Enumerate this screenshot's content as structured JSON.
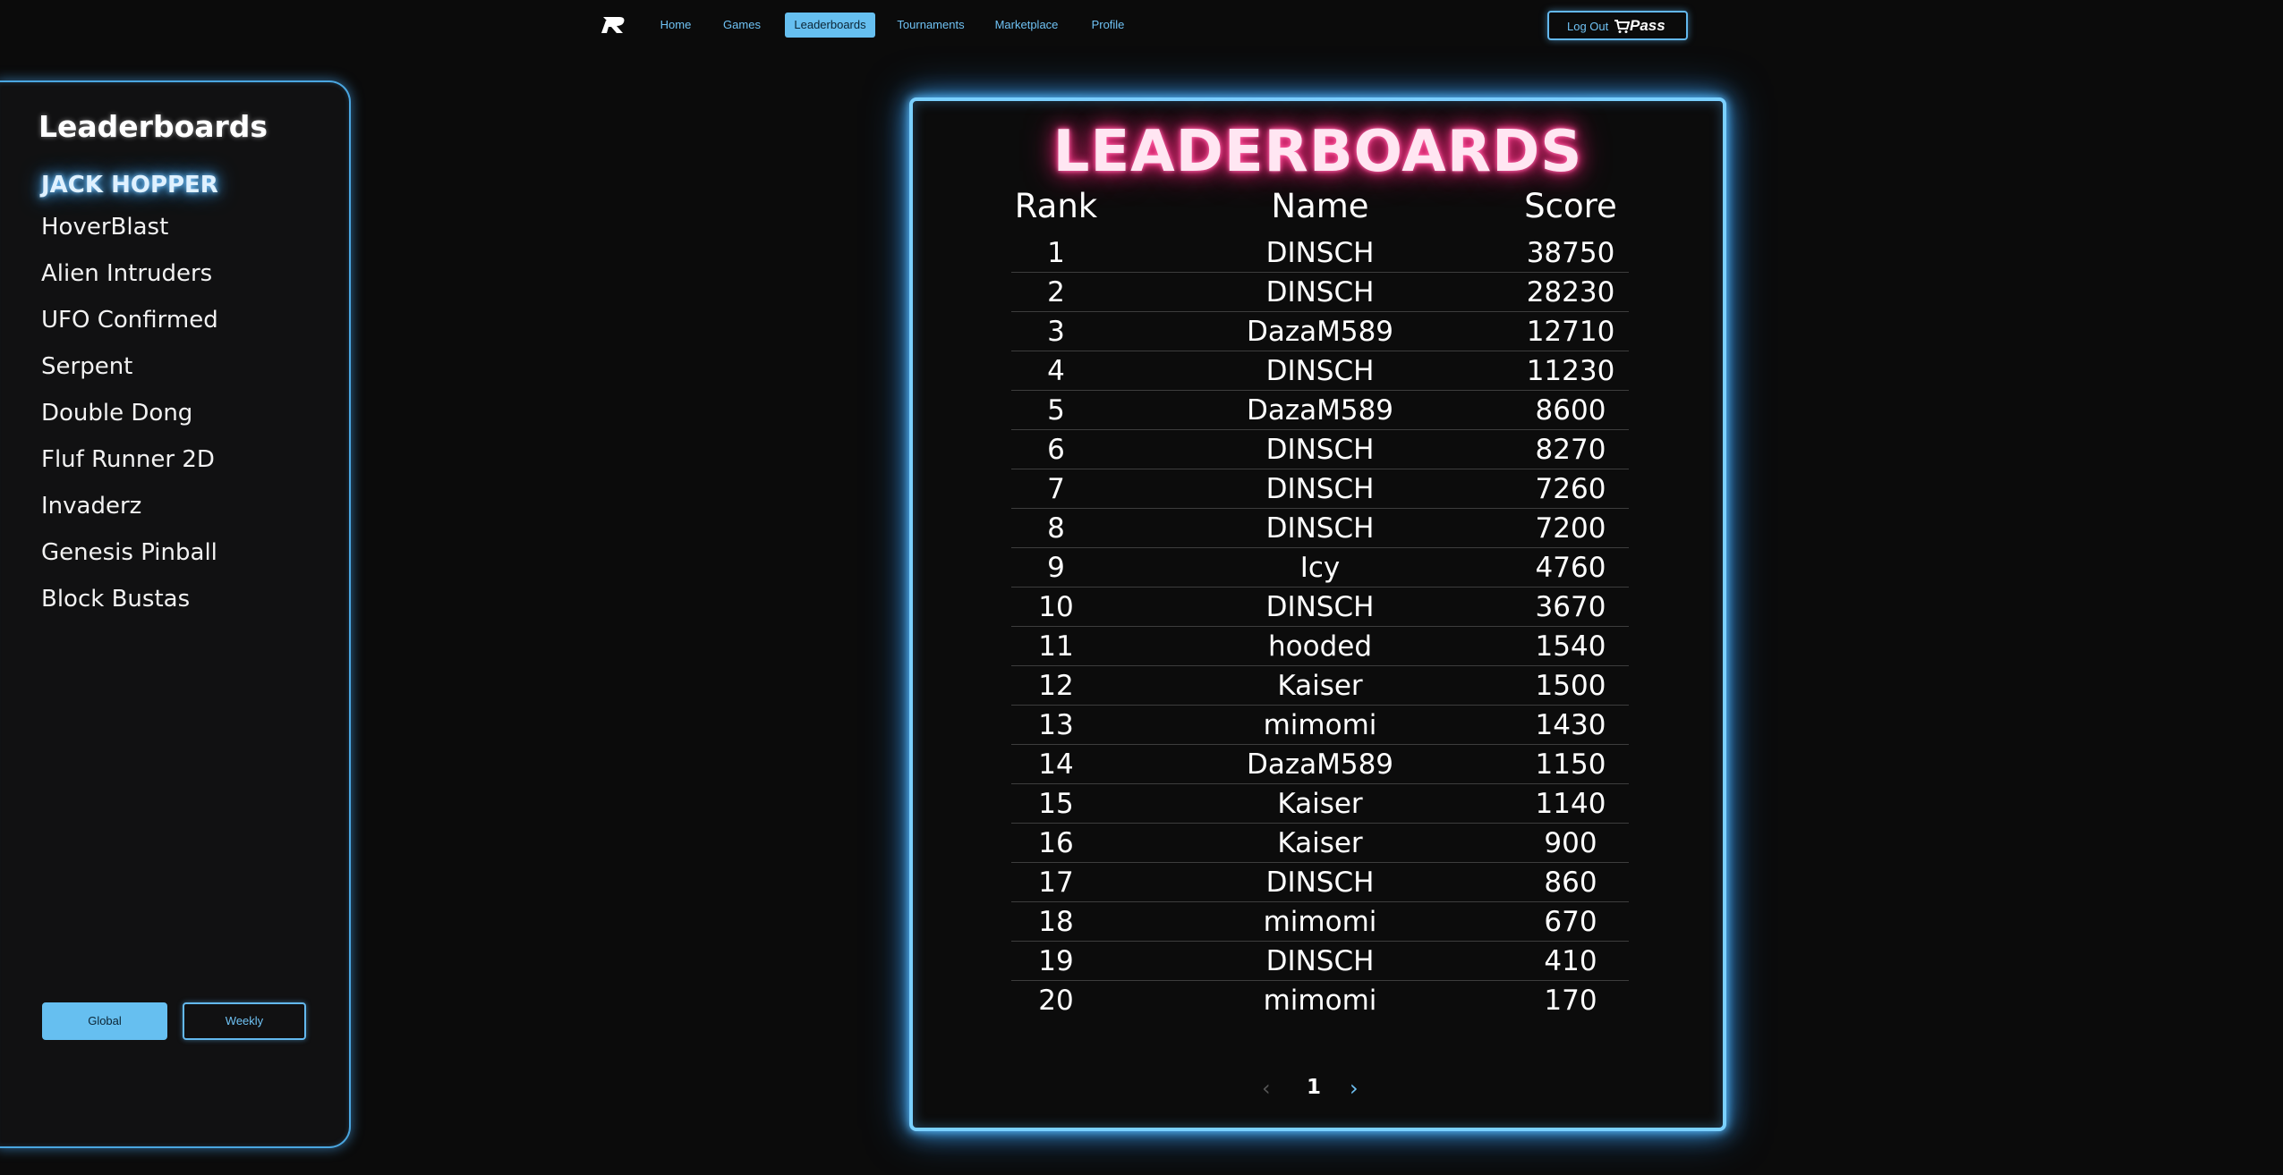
{
  "nav": {
    "logo_icon": "r-logo-icon",
    "items": [
      {
        "label": "Home"
      },
      {
        "label": "Games"
      },
      {
        "label": "Leaderboards",
        "active": true
      },
      {
        "label": "Tournaments"
      },
      {
        "label": "Marketplace"
      },
      {
        "label": "Profile"
      }
    ],
    "logout_label": "Log Out",
    "pass_label": "Pass",
    "pass_icon": "cart-icon"
  },
  "sidebar": {
    "title": "Leaderboards",
    "games": [
      {
        "label": "JACK HOPPER",
        "selected": true
      },
      {
        "label": "HoverBlast"
      },
      {
        "label": "Alien Intruders"
      },
      {
        "label": "UFO Confirmed"
      },
      {
        "label": "Serpent"
      },
      {
        "label": "Double Dong"
      },
      {
        "label": "Fluf Runner 2D"
      },
      {
        "label": "Invaderz"
      },
      {
        "label": "Genesis Pinball"
      },
      {
        "label": "Block Bustas"
      }
    ],
    "global_label": "Global",
    "weekly_label": "Weekly"
  },
  "board": {
    "title": "LEADERBOARDS",
    "headers": {
      "rank": "Rank",
      "name": "Name",
      "score": "Score"
    },
    "rows": [
      {
        "rank": "1",
        "name": "DINSCH",
        "score": "38750"
      },
      {
        "rank": "2",
        "name": "DINSCH",
        "score": "28230"
      },
      {
        "rank": "3",
        "name": "DazaM589",
        "score": "12710"
      },
      {
        "rank": "4",
        "name": "DINSCH",
        "score": "11230"
      },
      {
        "rank": "5",
        "name": "DazaM589",
        "score": "8600"
      },
      {
        "rank": "6",
        "name": "DINSCH",
        "score": "8270"
      },
      {
        "rank": "7",
        "name": "DINSCH",
        "score": "7260"
      },
      {
        "rank": "8",
        "name": "DINSCH",
        "score": "7200"
      },
      {
        "rank": "9",
        "name": "Icy",
        "score": "4760"
      },
      {
        "rank": "10",
        "name": "DINSCH",
        "score": "3670"
      },
      {
        "rank": "11",
        "name": "hooded",
        "score": "1540"
      },
      {
        "rank": "12",
        "name": "Kaiser",
        "score": "1500"
      },
      {
        "rank": "13",
        "name": "mimomi",
        "score": "1430"
      },
      {
        "rank": "14",
        "name": "DazaM589",
        "score": "1150"
      },
      {
        "rank": "15",
        "name": "Kaiser",
        "score": "1140"
      },
      {
        "rank": "16",
        "name": "Kaiser",
        "score": "900"
      },
      {
        "rank": "17",
        "name": "DINSCH",
        "score": "860"
      },
      {
        "rank": "18",
        "name": "mimomi",
        "score": "670"
      },
      {
        "rank": "19",
        "name": "DINSCH",
        "score": "410"
      },
      {
        "rank": "20",
        "name": "mimomi",
        "score": "170"
      }
    ],
    "pager": {
      "prev": "‹",
      "page": "1",
      "next": "›"
    }
  },
  "colors": {
    "accent": "#66bff0",
    "title_glow": "#ff3d8f",
    "background": "#0b0b0b"
  }
}
